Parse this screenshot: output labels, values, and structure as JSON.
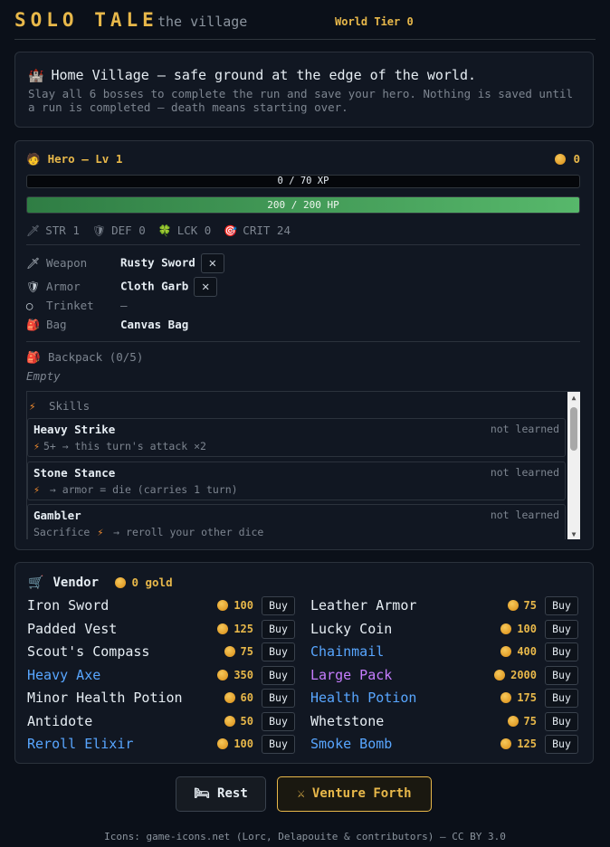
{
  "header": {
    "logo": "SOLO TALE",
    "subtitle": "the village",
    "tier": "World Tier 0"
  },
  "intro": {
    "icon": "castle-icon",
    "title": "Home Village — safe ground at the edge of the world.",
    "description": "Slay all 6 bosses to complete the run and save your hero. Nothing is saved until a run is completed — death means starting over."
  },
  "hero": {
    "title": "Hero — Lv 1",
    "gold": "0",
    "xp_text": "0 / 70 XP",
    "xp_fraction": 0,
    "hp_text": "200 / 200 HP",
    "hp_fraction": 1.0,
    "stats": [
      {
        "icon": "sword-icon",
        "glyph": "🗡",
        "label": "STR 1"
      },
      {
        "icon": "shield-icon",
        "glyph": "🛡",
        "label": "DEF 0"
      },
      {
        "icon": "clover-icon",
        "glyph": "🍀",
        "label": "LCK 0"
      },
      {
        "icon": "target-icon",
        "glyph": "🎯",
        "label": "CRIT 24"
      }
    ],
    "equipment": [
      {
        "slot": "Weapon",
        "value": "Rusty Sword",
        "removable": true,
        "glyph": "🗡"
      },
      {
        "slot": "Armor",
        "value": "Cloth Garb",
        "removable": true,
        "glyph": "🛡"
      },
      {
        "slot": "Trinket",
        "value": "—",
        "removable": false,
        "glyph": "◯"
      },
      {
        "slot": "Bag",
        "value": "Canvas Bag",
        "removable": false,
        "glyph": "🎒"
      }
    ],
    "backpack_label": "Backpack (0/5)",
    "backpack_empty": "Empty",
    "skills_label": "Skills",
    "skills": [
      {
        "name": "Heavy Strike",
        "status": "not learned",
        "prefix": "",
        "effect": "5+ → this turn's attack ×2"
      },
      {
        "name": "Stone Stance",
        "status": "not learned",
        "prefix": "",
        "effect": " → armor = die (carries 1 turn)"
      },
      {
        "name": "Gambler",
        "status": "not learned",
        "prefix": "Sacrifice",
        "effect": " → reroll your other dice"
      }
    ]
  },
  "vendor": {
    "title": "Vendor",
    "gold": "0 gold",
    "buy_label": "Buy",
    "items": [
      {
        "name": "Iron Sword",
        "price": "100",
        "rarity": "common"
      },
      {
        "name": "Leather Armor",
        "price": "75",
        "rarity": "common"
      },
      {
        "name": "Padded Vest",
        "price": "125",
        "rarity": "common"
      },
      {
        "name": "Lucky Coin",
        "price": "100",
        "rarity": "common"
      },
      {
        "name": "Scout's Compass",
        "price": "75",
        "rarity": "common"
      },
      {
        "name": "Chainmail",
        "price": "400",
        "rarity": "rare"
      },
      {
        "name": "Heavy Axe",
        "price": "350",
        "rarity": "rare"
      },
      {
        "name": "Large Pack",
        "price": "2000",
        "rarity": "epic"
      },
      {
        "name": "Minor Health Potion",
        "price": "60",
        "rarity": "common"
      },
      {
        "name": "Health Potion",
        "price": "175",
        "rarity": "rare"
      },
      {
        "name": "Antidote",
        "price": "50",
        "rarity": "common"
      },
      {
        "name": "Whetstone",
        "price": "75",
        "rarity": "common"
      },
      {
        "name": "Reroll Elixir",
        "price": "100",
        "rarity": "rare"
      },
      {
        "name": "Smoke Bomb",
        "price": "125",
        "rarity": "rare"
      }
    ]
  },
  "actions": {
    "rest": "Rest",
    "venture": "Venture Forth"
  },
  "footer": "Icons: game-icons.net (Lorc, Delapouite & contributors) — CC BY 3.0",
  "colors": {
    "accent": "#e8b84a",
    "rare": "#58a6ff",
    "epic": "#c77dff",
    "hp": "#57b86b"
  }
}
